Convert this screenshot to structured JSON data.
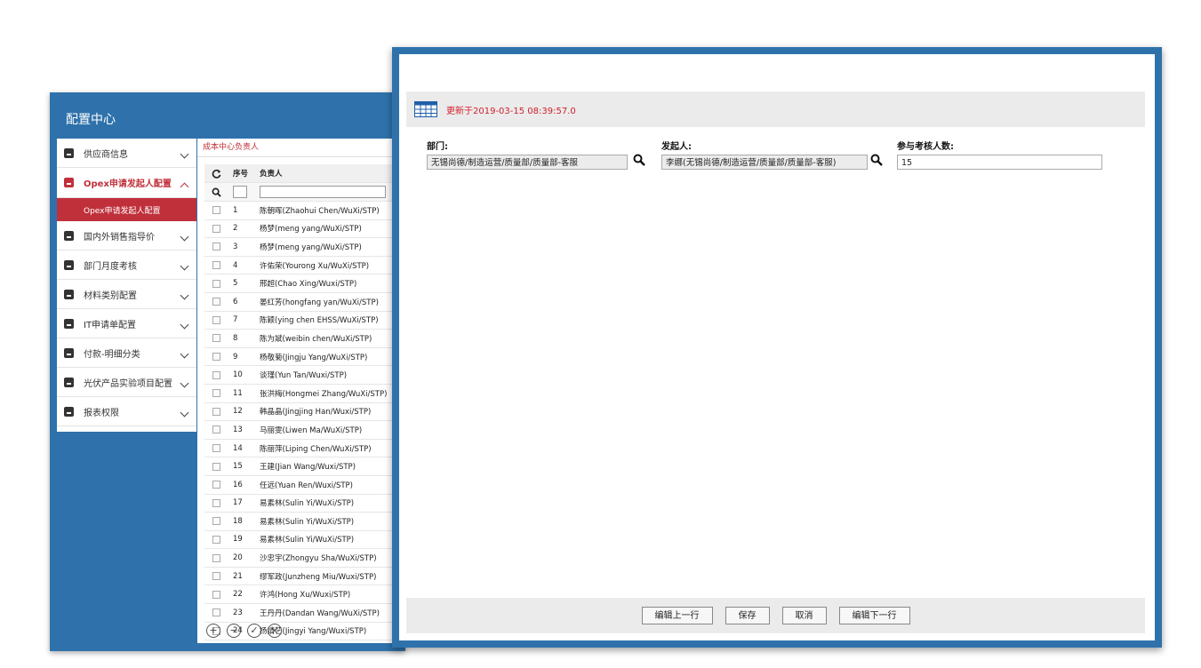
{
  "back_window": {
    "title": "配置中心",
    "menu": [
      {
        "label": "供应商信息",
        "active": false
      },
      {
        "label": "Opex申请发起人配置",
        "active": true,
        "sub": "Opex申请发起人配置"
      },
      {
        "label": "国内外销售指导价",
        "active": false
      },
      {
        "label": "部门月度考核",
        "active": false
      },
      {
        "label": "材料类别配置",
        "active": false
      },
      {
        "label": "IT申请单配置",
        "active": false
      },
      {
        "label": "付款-明细分类",
        "active": false
      },
      {
        "label": "光伏产品实验项目配置",
        "active": false
      },
      {
        "label": "报表权限",
        "active": false
      }
    ],
    "grid": {
      "caption": "成本中心负责人",
      "col_seq": "序号",
      "col_person": "负责人",
      "rows": [
        {
          "seq": "1",
          "person": "陈朝晖(Zhaohui Chen/WuXi/STP)"
        },
        {
          "seq": "2",
          "person": "杨梦(meng yang/WuXi/STP)"
        },
        {
          "seq": "3",
          "person": "杨梦(meng yang/WuXi/STP)"
        },
        {
          "seq": "4",
          "person": "许佑荣(Yourong Xu/WuXi/STP)"
        },
        {
          "seq": "5",
          "person": "邢超(Chao Xing/Wuxi/STP)"
        },
        {
          "seq": "6",
          "person": "晏红芳(hongfang yan/WuXi/STP)"
        },
        {
          "seq": "7",
          "person": "陈颖(ying chen EHSS/WuXi/STP)"
        },
        {
          "seq": "8",
          "person": "陈为斌(weibin chen/WuXi/STP)"
        },
        {
          "seq": "9",
          "person": "杨敬菊(Jingju Yang/WuXi/STP)"
        },
        {
          "seq": "10",
          "person": "谈瑾(Yun Tan/Wuxi/STP)"
        },
        {
          "seq": "11",
          "person": "张洪梅(Hongmei Zhang/WuXi/STP)"
        },
        {
          "seq": "12",
          "person": "韩晶晶(Jingjing Han/Wuxi/STP)"
        },
        {
          "seq": "13",
          "person": "马丽雯(Liwen Ma/WuXi/STP)"
        },
        {
          "seq": "14",
          "person": "陈丽萍(Liping Chen/WuXi/STP)"
        },
        {
          "seq": "15",
          "person": "王建(Jian Wang/Wuxi/STP)"
        },
        {
          "seq": "16",
          "person": "任远(Yuan Ren/Wuxi/STP)"
        },
        {
          "seq": "17",
          "person": "易素林(Sulin Yi/WuXi/STP)"
        },
        {
          "seq": "18",
          "person": "易素林(Sulin Yi/WuXi/STP)"
        },
        {
          "seq": "19",
          "person": "易素林(Sulin Yi/WuXi/STP)"
        },
        {
          "seq": "20",
          "person": "沙忠宇(Zhongyu Sha/WuXi/STP)"
        },
        {
          "seq": "21",
          "person": "缪军政(Junzheng Miu/Wuxi/STP)"
        },
        {
          "seq": "22",
          "person": "许鸿(Hong Xu/Wuxi/STP)"
        },
        {
          "seq": "23",
          "person": "王丹丹(Dandan Wang/WuXi/STP)"
        },
        {
          "seq": "24",
          "person": "杨婧艺(Jingyi Yang/Wuxi/STP)"
        }
      ]
    }
  },
  "dialog": {
    "update_text": "更新于2019-03-15 08:39:57.0",
    "dept_label": "部门:",
    "dept_value": "无锡尚德/制造运营/质量部/质量部-客服",
    "initiator_label": "发起人:",
    "initiator_value": "李娜(无锡尚德/制造运营/质量部/质量部-客服)",
    "count_label": "参与考核人数:",
    "count_value": "15",
    "buttons": {
      "prev": "编辑上一行",
      "save": "保存",
      "cancel": "取消",
      "next": "编辑下一行"
    }
  },
  "colors": {
    "accent": "#2f72ab",
    "active": "#c0303b",
    "update_text": "#d0202b"
  }
}
